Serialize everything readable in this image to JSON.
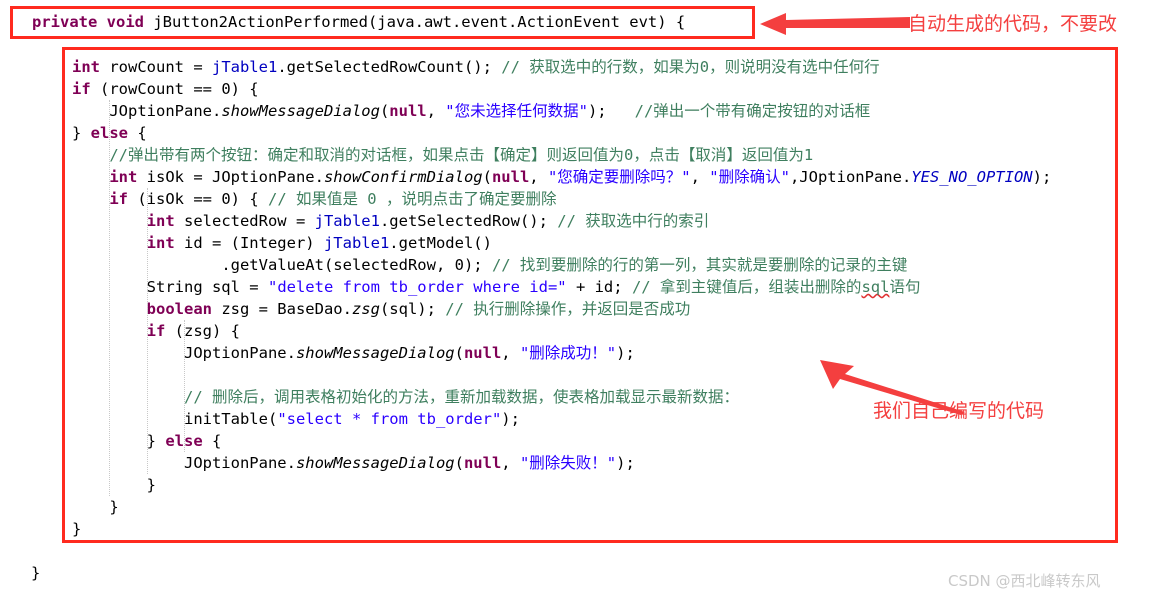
{
  "colors": {
    "annotation_red": "#f43f3f",
    "box_border_red": "#ff2a1f",
    "keyword": "#7f0055",
    "string": "#2a00ff",
    "comment": "#3f7f5f",
    "field": "#0000c0",
    "watermark": "#c9c9c9",
    "background": "#ffffff"
  },
  "signature": {
    "kw_private": "private",
    "space1": " ",
    "kw_void": "void",
    "rest": " jButton2ActionPerformed(java.awt.event.ActionEvent evt) {"
  },
  "annotations": {
    "top": {
      "text": "自动生成的代码，不要改",
      "icon": "left-arrow-icon"
    },
    "middle": {
      "text": "我们自己编写的代码",
      "icon": "up-left-arrow-icon"
    }
  },
  "closing_brace": "}",
  "watermark": "CSDN @西北峰转东风",
  "code": {
    "lines": [
      {
        "indent": "",
        "tokens": [
          {
            "t": "kw",
            "v": "int"
          },
          {
            "t": "plain",
            "v": " rowCount = "
          },
          {
            "t": "field",
            "v": "jTable1"
          },
          {
            "t": "plain",
            "v": ".getSelectedRowCount(); "
          },
          {
            "t": "cmt",
            "v": "// 获取选中的行数，如果为0，则说明没有选中任何行"
          }
        ]
      },
      {
        "indent": "",
        "tokens": [
          {
            "t": "kw",
            "v": "if"
          },
          {
            "t": "plain",
            "v": " (rowCount == 0) {"
          }
        ]
      },
      {
        "indent": "    ",
        "tokens": [
          {
            "t": "plain",
            "v": "JOptionPane."
          },
          {
            "t": "method",
            "v": "showMessageDialog"
          },
          {
            "t": "plain",
            "v": "("
          },
          {
            "t": "kw",
            "v": "null"
          },
          {
            "t": "plain",
            "v": ", "
          },
          {
            "t": "str",
            "v": "\"您未选择任何数据\""
          },
          {
            "t": "plain",
            "v": ");   "
          },
          {
            "t": "cmt",
            "v": "//弹出一个带有确定按钮的对话框"
          }
        ]
      },
      {
        "indent": "",
        "tokens": [
          {
            "t": "plain",
            "v": "} "
          },
          {
            "t": "kw",
            "v": "else"
          },
          {
            "t": "plain",
            "v": " {"
          }
        ]
      },
      {
        "indent": "    ",
        "tokens": [
          {
            "t": "cmt",
            "v": "//弹出带有两个按钮：确定和取消的对话框，如果点击【确定】则返回值为0，点击【取消】返回值为1"
          }
        ]
      },
      {
        "indent": "    ",
        "tokens": [
          {
            "t": "kw",
            "v": "int"
          },
          {
            "t": "plain",
            "v": " isOk = JOptionPane."
          },
          {
            "t": "method",
            "v": "showConfirmDialog"
          },
          {
            "t": "plain",
            "v": "("
          },
          {
            "t": "kw",
            "v": "null"
          },
          {
            "t": "plain",
            "v": ", "
          },
          {
            "t": "str",
            "v": "\"您确定要删除吗？\""
          },
          {
            "t": "plain",
            "v": ", "
          },
          {
            "t": "str",
            "v": "\"删除确认\""
          },
          {
            "t": "plain",
            "v": ",JOptionPane."
          },
          {
            "t": "static",
            "v": "YES_NO_OPTION"
          },
          {
            "t": "plain",
            "v": ");"
          }
        ]
      },
      {
        "indent": "    ",
        "tokens": [
          {
            "t": "kw",
            "v": "if"
          },
          {
            "t": "plain",
            "v": " (isOk == 0) { "
          },
          {
            "t": "cmt",
            "v": "// 如果值是 0 ，说明点击了确定要删除"
          }
        ]
      },
      {
        "indent": "        ",
        "tokens": [
          {
            "t": "kw",
            "v": "int"
          },
          {
            "t": "plain",
            "v": " selectedRow = "
          },
          {
            "t": "field",
            "v": "jTable1"
          },
          {
            "t": "plain",
            "v": ".getSelectedRow(); "
          },
          {
            "t": "cmt",
            "v": "// 获取选中行的索引"
          }
        ]
      },
      {
        "indent": "        ",
        "tokens": [
          {
            "t": "kw",
            "v": "int"
          },
          {
            "t": "plain",
            "v": " id = (Integer) "
          },
          {
            "t": "field",
            "v": "jTable1"
          },
          {
            "t": "plain",
            "v": ".getModel()"
          }
        ]
      },
      {
        "indent": "                ",
        "tokens": [
          {
            "t": "plain",
            "v": ".getValueAt(selectedRow, 0); "
          },
          {
            "t": "cmt",
            "v": "// 找到要删除的行的第一列，其实就是要删除的记录的主键"
          }
        ]
      },
      {
        "indent": "        ",
        "tokens": [
          {
            "t": "plain",
            "v": "String sql = "
          },
          {
            "t": "str",
            "v": "\"delete from tb_order where id=\""
          },
          {
            "t": "plain",
            "v": " + id; "
          },
          {
            "t": "cmt",
            "v": "// 拿到主键值后，组装出删除的"
          },
          {
            "t": "cmt-squiggle",
            "v": "sql"
          },
          {
            "t": "cmt",
            "v": "语句"
          }
        ]
      },
      {
        "indent": "        ",
        "tokens": [
          {
            "t": "kw",
            "v": "boolean"
          },
          {
            "t": "plain",
            "v": " zsg = BaseDao."
          },
          {
            "t": "method",
            "v": "zsg"
          },
          {
            "t": "plain",
            "v": "(sql); "
          },
          {
            "t": "cmt",
            "v": "// 执行删除操作，并返回是否成功"
          }
        ]
      },
      {
        "indent": "        ",
        "tokens": [
          {
            "t": "kw",
            "v": "if"
          },
          {
            "t": "plain",
            "v": " (zsg) {"
          }
        ]
      },
      {
        "indent": "            ",
        "tokens": [
          {
            "t": "plain",
            "v": "JOptionPane."
          },
          {
            "t": "method",
            "v": "showMessageDialog"
          },
          {
            "t": "plain",
            "v": "("
          },
          {
            "t": "kw",
            "v": "null"
          },
          {
            "t": "plain",
            "v": ", "
          },
          {
            "t": "str",
            "v": "\"删除成功！\""
          },
          {
            "t": "plain",
            "v": ");"
          }
        ]
      },
      {
        "indent": "",
        "tokens": []
      },
      {
        "indent": "            ",
        "tokens": [
          {
            "t": "cmt",
            "v": "// 删除后，调用表格初始化的方法，重新加载数据，使表格加载显示最新数据："
          }
        ]
      },
      {
        "indent": "            ",
        "tokens": [
          {
            "t": "plain",
            "v": "initTable("
          },
          {
            "t": "str",
            "v": "\"select * from tb_order\""
          },
          {
            "t": "plain",
            "v": ");"
          }
        ]
      },
      {
        "indent": "        ",
        "tokens": [
          {
            "t": "plain",
            "v": "} "
          },
          {
            "t": "kw",
            "v": "else"
          },
          {
            "t": "plain",
            "v": " {"
          }
        ]
      },
      {
        "indent": "            ",
        "tokens": [
          {
            "t": "plain",
            "v": "JOptionPane."
          },
          {
            "t": "method",
            "v": "showMessageDialog"
          },
          {
            "t": "plain",
            "v": "("
          },
          {
            "t": "kw",
            "v": "null"
          },
          {
            "t": "plain",
            "v": ", "
          },
          {
            "t": "str",
            "v": "\"删除失败！\""
          },
          {
            "t": "plain",
            "v": ");"
          }
        ]
      },
      {
        "indent": "        ",
        "tokens": [
          {
            "t": "plain",
            "v": "}"
          }
        ]
      },
      {
        "indent": "    ",
        "tokens": [
          {
            "t": "plain",
            "v": "}"
          }
        ]
      },
      {
        "indent": "",
        "tokens": [
          {
            "t": "plain",
            "v": "}"
          }
        ]
      }
    ]
  }
}
